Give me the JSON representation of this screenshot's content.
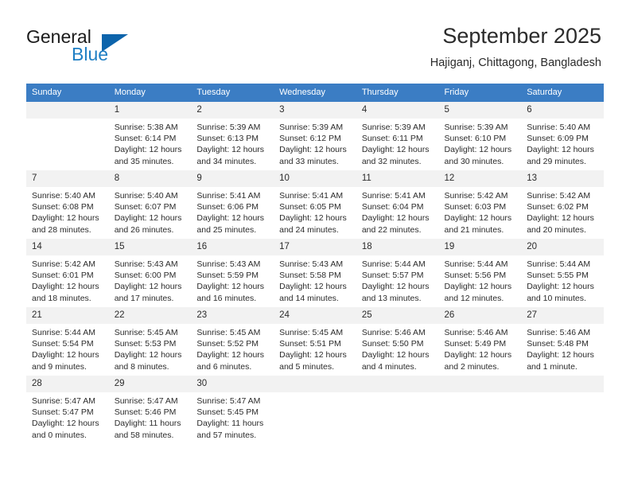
{
  "brand": {
    "name_part1": "General",
    "name_part2": "Blue",
    "accent_color": "#0d64ab",
    "blue_text_color": "#1f7fc4"
  },
  "header": {
    "title": "September 2025",
    "location": "Hajiganj, Chittagong, Bangladesh"
  },
  "calendar": {
    "header_bg": "#3b7dc4",
    "daynum_bg": "#f2f2f2",
    "weekdays": [
      "Sunday",
      "Monday",
      "Tuesday",
      "Wednesday",
      "Thursday",
      "Friday",
      "Saturday"
    ],
    "weeks": [
      [
        {
          "empty": true,
          "day": "",
          "sunrise": "",
          "sunset": "",
          "daylight1": "",
          "daylight2": ""
        },
        {
          "empty": false,
          "day": "1",
          "sunrise": "Sunrise: 5:38 AM",
          "sunset": "Sunset: 6:14 PM",
          "daylight1": "Daylight: 12 hours",
          "daylight2": "and 35 minutes."
        },
        {
          "empty": false,
          "day": "2",
          "sunrise": "Sunrise: 5:39 AM",
          "sunset": "Sunset: 6:13 PM",
          "daylight1": "Daylight: 12 hours",
          "daylight2": "and 34 minutes."
        },
        {
          "empty": false,
          "day": "3",
          "sunrise": "Sunrise: 5:39 AM",
          "sunset": "Sunset: 6:12 PM",
          "daylight1": "Daylight: 12 hours",
          "daylight2": "and 33 minutes."
        },
        {
          "empty": false,
          "day": "4",
          "sunrise": "Sunrise: 5:39 AM",
          "sunset": "Sunset: 6:11 PM",
          "daylight1": "Daylight: 12 hours",
          "daylight2": "and 32 minutes."
        },
        {
          "empty": false,
          "day": "5",
          "sunrise": "Sunrise: 5:39 AM",
          "sunset": "Sunset: 6:10 PM",
          "daylight1": "Daylight: 12 hours",
          "daylight2": "and 30 minutes."
        },
        {
          "empty": false,
          "day": "6",
          "sunrise": "Sunrise: 5:40 AM",
          "sunset": "Sunset: 6:09 PM",
          "daylight1": "Daylight: 12 hours",
          "daylight2": "and 29 minutes."
        }
      ],
      [
        {
          "empty": false,
          "day": "7",
          "sunrise": "Sunrise: 5:40 AM",
          "sunset": "Sunset: 6:08 PM",
          "daylight1": "Daylight: 12 hours",
          "daylight2": "and 28 minutes."
        },
        {
          "empty": false,
          "day": "8",
          "sunrise": "Sunrise: 5:40 AM",
          "sunset": "Sunset: 6:07 PM",
          "daylight1": "Daylight: 12 hours",
          "daylight2": "and 26 minutes."
        },
        {
          "empty": false,
          "day": "9",
          "sunrise": "Sunrise: 5:41 AM",
          "sunset": "Sunset: 6:06 PM",
          "daylight1": "Daylight: 12 hours",
          "daylight2": "and 25 minutes."
        },
        {
          "empty": false,
          "day": "10",
          "sunrise": "Sunrise: 5:41 AM",
          "sunset": "Sunset: 6:05 PM",
          "daylight1": "Daylight: 12 hours",
          "daylight2": "and 24 minutes."
        },
        {
          "empty": false,
          "day": "11",
          "sunrise": "Sunrise: 5:41 AM",
          "sunset": "Sunset: 6:04 PM",
          "daylight1": "Daylight: 12 hours",
          "daylight2": "and 22 minutes."
        },
        {
          "empty": false,
          "day": "12",
          "sunrise": "Sunrise: 5:42 AM",
          "sunset": "Sunset: 6:03 PM",
          "daylight1": "Daylight: 12 hours",
          "daylight2": "and 21 minutes."
        },
        {
          "empty": false,
          "day": "13",
          "sunrise": "Sunrise: 5:42 AM",
          "sunset": "Sunset: 6:02 PM",
          "daylight1": "Daylight: 12 hours",
          "daylight2": "and 20 minutes."
        }
      ],
      [
        {
          "empty": false,
          "day": "14",
          "sunrise": "Sunrise: 5:42 AM",
          "sunset": "Sunset: 6:01 PM",
          "daylight1": "Daylight: 12 hours",
          "daylight2": "and 18 minutes."
        },
        {
          "empty": false,
          "day": "15",
          "sunrise": "Sunrise: 5:43 AM",
          "sunset": "Sunset: 6:00 PM",
          "daylight1": "Daylight: 12 hours",
          "daylight2": "and 17 minutes."
        },
        {
          "empty": false,
          "day": "16",
          "sunrise": "Sunrise: 5:43 AM",
          "sunset": "Sunset: 5:59 PM",
          "daylight1": "Daylight: 12 hours",
          "daylight2": "and 16 minutes."
        },
        {
          "empty": false,
          "day": "17",
          "sunrise": "Sunrise: 5:43 AM",
          "sunset": "Sunset: 5:58 PM",
          "daylight1": "Daylight: 12 hours",
          "daylight2": "and 14 minutes."
        },
        {
          "empty": false,
          "day": "18",
          "sunrise": "Sunrise: 5:44 AM",
          "sunset": "Sunset: 5:57 PM",
          "daylight1": "Daylight: 12 hours",
          "daylight2": "and 13 minutes."
        },
        {
          "empty": false,
          "day": "19",
          "sunrise": "Sunrise: 5:44 AM",
          "sunset": "Sunset: 5:56 PM",
          "daylight1": "Daylight: 12 hours",
          "daylight2": "and 12 minutes."
        },
        {
          "empty": false,
          "day": "20",
          "sunrise": "Sunrise: 5:44 AM",
          "sunset": "Sunset: 5:55 PM",
          "daylight1": "Daylight: 12 hours",
          "daylight2": "and 10 minutes."
        }
      ],
      [
        {
          "empty": false,
          "day": "21",
          "sunrise": "Sunrise: 5:44 AM",
          "sunset": "Sunset: 5:54 PM",
          "daylight1": "Daylight: 12 hours",
          "daylight2": "and 9 minutes."
        },
        {
          "empty": false,
          "day": "22",
          "sunrise": "Sunrise: 5:45 AM",
          "sunset": "Sunset: 5:53 PM",
          "daylight1": "Daylight: 12 hours",
          "daylight2": "and 8 minutes."
        },
        {
          "empty": false,
          "day": "23",
          "sunrise": "Sunrise: 5:45 AM",
          "sunset": "Sunset: 5:52 PM",
          "daylight1": "Daylight: 12 hours",
          "daylight2": "and 6 minutes."
        },
        {
          "empty": false,
          "day": "24",
          "sunrise": "Sunrise: 5:45 AM",
          "sunset": "Sunset: 5:51 PM",
          "daylight1": "Daylight: 12 hours",
          "daylight2": "and 5 minutes."
        },
        {
          "empty": false,
          "day": "25",
          "sunrise": "Sunrise: 5:46 AM",
          "sunset": "Sunset: 5:50 PM",
          "daylight1": "Daylight: 12 hours",
          "daylight2": "and 4 minutes."
        },
        {
          "empty": false,
          "day": "26",
          "sunrise": "Sunrise: 5:46 AM",
          "sunset": "Sunset: 5:49 PM",
          "daylight1": "Daylight: 12 hours",
          "daylight2": "and 2 minutes."
        },
        {
          "empty": false,
          "day": "27",
          "sunrise": "Sunrise: 5:46 AM",
          "sunset": "Sunset: 5:48 PM",
          "daylight1": "Daylight: 12 hours",
          "daylight2": "and 1 minute."
        }
      ],
      [
        {
          "empty": false,
          "day": "28",
          "sunrise": "Sunrise: 5:47 AM",
          "sunset": "Sunset: 5:47 PM",
          "daylight1": "Daylight: 12 hours",
          "daylight2": "and 0 minutes."
        },
        {
          "empty": false,
          "day": "29",
          "sunrise": "Sunrise: 5:47 AM",
          "sunset": "Sunset: 5:46 PM",
          "daylight1": "Daylight: 11 hours",
          "daylight2": "and 58 minutes."
        },
        {
          "empty": false,
          "day": "30",
          "sunrise": "Sunrise: 5:47 AM",
          "sunset": "Sunset: 5:45 PM",
          "daylight1": "Daylight: 11 hours",
          "daylight2": "and 57 minutes."
        },
        {
          "empty": true,
          "day": "",
          "sunrise": "",
          "sunset": "",
          "daylight1": "",
          "daylight2": ""
        },
        {
          "empty": true,
          "day": "",
          "sunrise": "",
          "sunset": "",
          "daylight1": "",
          "daylight2": ""
        },
        {
          "empty": true,
          "day": "",
          "sunrise": "",
          "sunset": "",
          "daylight1": "",
          "daylight2": ""
        },
        {
          "empty": true,
          "day": "",
          "sunrise": "",
          "sunset": "",
          "daylight1": "",
          "daylight2": ""
        }
      ]
    ]
  }
}
